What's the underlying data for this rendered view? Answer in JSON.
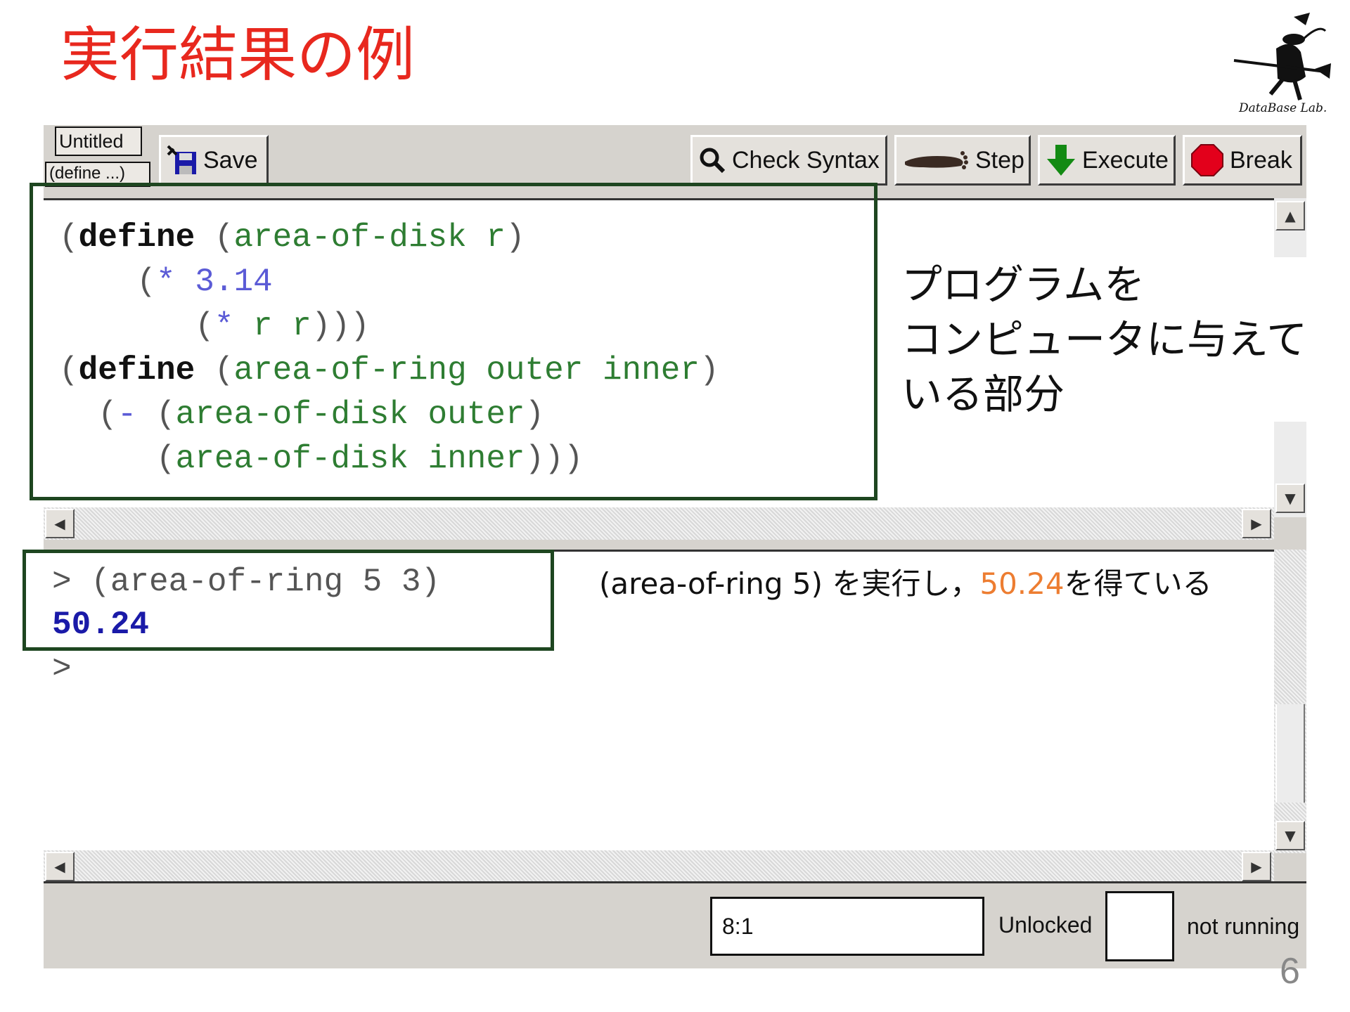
{
  "slide": {
    "title": "実行結果の例",
    "logo_caption": "DataBase Lab.",
    "page_number": "6"
  },
  "window": {
    "tabs": [
      "Untitled",
      "(define ...)"
    ],
    "toolbar": {
      "save_label": "Save",
      "check_syntax_label": "Check Syntax",
      "step_label": "Step",
      "execute_label": "Execute",
      "break_label": "Break"
    },
    "definitions": [
      {
        "indent": "",
        "parts": [
          {
            "t": "(",
            "c": "p"
          },
          {
            "t": "define",
            "c": "k"
          },
          {
            "t": " (",
            "c": "p"
          },
          {
            "t": "area-of-disk r",
            "c": "g"
          },
          {
            "t": ")",
            "c": "p"
          }
        ]
      },
      {
        "indent": "    ",
        "parts": [
          {
            "t": "(",
            "c": "p"
          },
          {
            "t": "* 3.14",
            "c": "b"
          }
        ]
      },
      {
        "indent": "       ",
        "parts": [
          {
            "t": "(",
            "c": "p"
          },
          {
            "t": "*",
            "c": "b"
          },
          {
            "t": " r r",
            "c": "g"
          },
          {
            "t": ")))",
            "c": "p"
          }
        ]
      },
      {
        "indent": "",
        "parts": [
          {
            "t": "(",
            "c": "p"
          },
          {
            "t": "define",
            "c": "k"
          },
          {
            "t": " (",
            "c": "p"
          },
          {
            "t": "area-of-ring outer inner",
            "c": "g"
          },
          {
            "t": ")",
            "c": "p"
          }
        ]
      },
      {
        "indent": "  ",
        "parts": [
          {
            "t": "(",
            "c": "p"
          },
          {
            "t": "-",
            "c": "b"
          },
          {
            "t": " (",
            "c": "p"
          },
          {
            "t": "area-of-disk outer",
            "c": "g"
          },
          {
            "t": ")",
            "c": "p"
          }
        ]
      },
      {
        "indent": "     ",
        "parts": [
          {
            "t": "(",
            "c": "p"
          },
          {
            "t": "area-of-disk inner",
            "c": "g"
          },
          {
            "t": ")))",
            "c": "p"
          }
        ]
      }
    ],
    "interactions": {
      "input_line": "> (area-of-ring 5 3)",
      "result": "50.24",
      "prompt": ">"
    },
    "status": {
      "position": "8:1",
      "lock_state": "Unlocked",
      "run_state": "not running"
    }
  },
  "annotations": {
    "program_note_lines": [
      "プログラムを",
      "コンピュータに与えて",
      "いる部分"
    ],
    "exec_note_prefix": "(area-of-ring 5) を実行し，",
    "exec_note_value": "50.24",
    "exec_note_suffix": "を得ている"
  },
  "colors": {
    "title": "#e8281e",
    "keyword": "#111111",
    "identifier": "#2e7d32",
    "primitive": "#5b5bd6",
    "result": "#1a1aa8",
    "highlight_box": "#1e4620",
    "annotation_accent": "#ed7d31"
  },
  "icons": [
    "save-icon",
    "magnifier-icon",
    "foot-icon",
    "down-arrow-icon",
    "stop-icon",
    "scroll-up-icon",
    "scroll-down-icon",
    "scroll-left-icon",
    "scroll-right-icon",
    "witch-logo"
  ]
}
